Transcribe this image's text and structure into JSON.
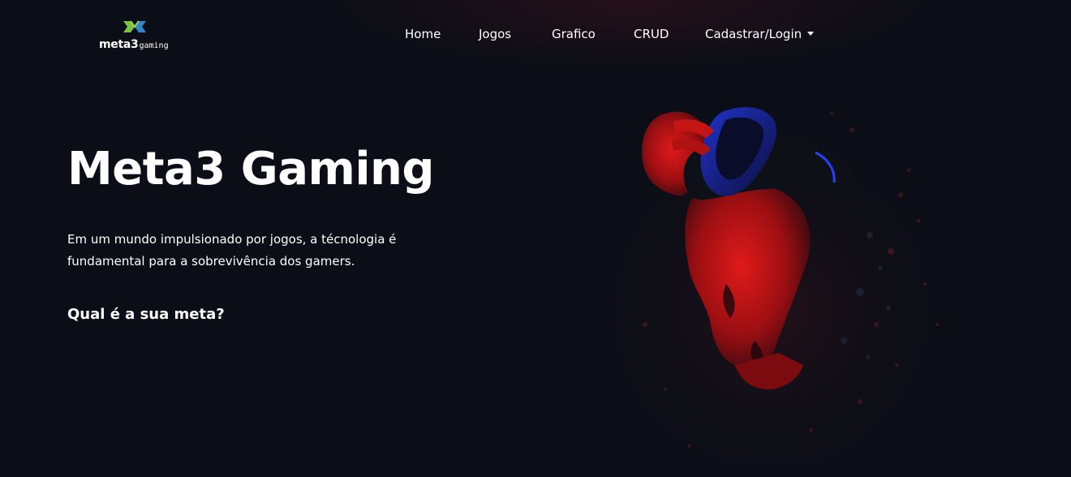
{
  "logo": {
    "brand": "meta3",
    "sub": "gaming"
  },
  "nav": {
    "items": [
      {
        "label": "Home"
      },
      {
        "label": "Jogos"
      },
      {
        "label": "Grafico"
      },
      {
        "label": "CRUD"
      },
      {
        "label": "Cadastrar/Login"
      }
    ]
  },
  "hero": {
    "title": "Meta3 Gaming",
    "text": "Em um mundo impulsionado por jogos, a técnologia é fundamental para a sobrevivência dos gamers.",
    "question": "Qual é a sua meta?"
  },
  "colors": {
    "background": "#0c0e17",
    "text": "#ffffff",
    "logo_green": "#7cc242",
    "logo_blue": "#2f86c8",
    "illustration_red": "#d81818",
    "illustration_blue": "#1f3fcf"
  }
}
